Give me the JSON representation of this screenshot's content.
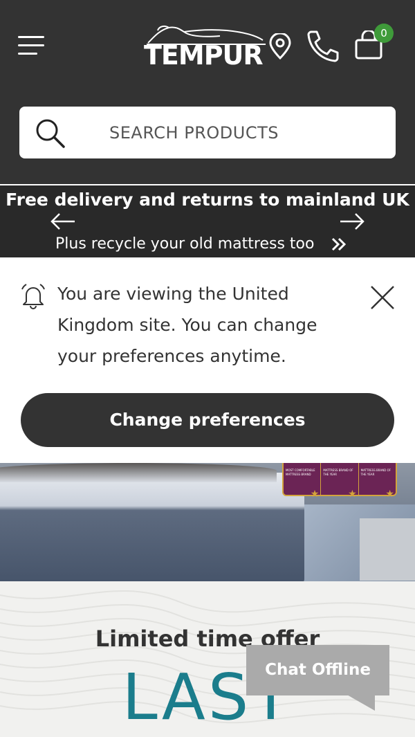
{
  "header": {
    "brand": "TEMPUR",
    "cart_count": "0",
    "icons": [
      "menu-icon",
      "store-locator-icon",
      "phone-icon",
      "cart-icon"
    ]
  },
  "search": {
    "placeholder": "SEARCH PRODUCTS"
  },
  "promo": {
    "title": "Free delivery and returns to mainland UK",
    "subtitle": "Plus recycle your old mattress too"
  },
  "notice": {
    "message": "You are viewing the United Kingdom site. You can change your preferences anytime.",
    "button_label": "Change preferences"
  },
  "hero": {
    "awards": [
      {
        "text": "MOST COMFORTABLE MATTRESS BRAND"
      },
      {
        "text": "MATTRESS BRAND OF THE YEAR"
      },
      {
        "text": "MATTRESS BRAND OF THE YEAR"
      }
    ]
  },
  "offer": {
    "label": "Limited time offer",
    "headline": "LAST"
  },
  "chat": {
    "label": "Chat Offline"
  },
  "colors": {
    "header_bg": "#333333",
    "promo_bg": "#292929",
    "badge_green": "#3f9b3a",
    "offer_teal": "#1b7d8c",
    "chat_grey": "#aaaaaa"
  }
}
